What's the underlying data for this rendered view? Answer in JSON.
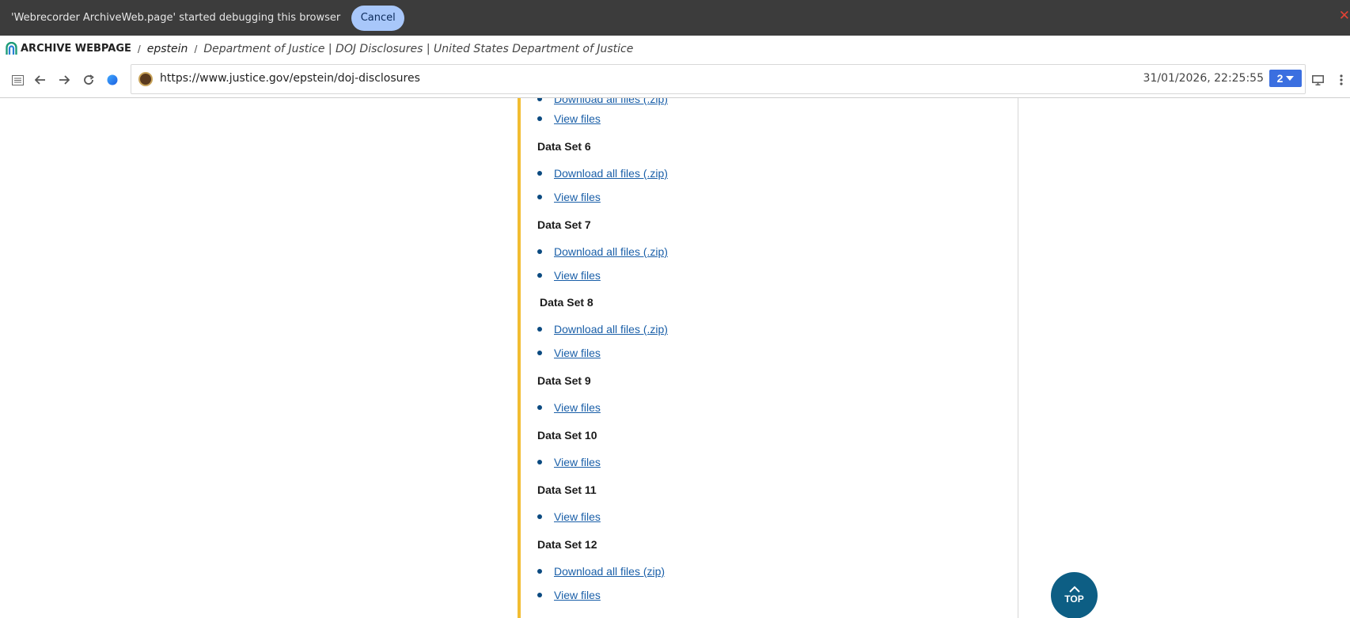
{
  "debug_banner": {
    "message": "'Webrecorder ArchiveWeb.page' started debugging this browser",
    "cancel_label": "Cancel",
    "close_symbol": "✕"
  },
  "archive_bar": {
    "app_title": "ARCHIVE WEBPAGE",
    "separator": "/",
    "collection": "epstein",
    "page_title": "Department of Justice | DOJ Disclosures | United States Department of Justice"
  },
  "nav": {
    "url": "https://www.justice.gov/epstein/doj-disclosures",
    "timestamp": "31/01/2026, 22:25:55",
    "version_count": "2",
    "icons": [
      "sidebar-icon",
      "back-icon",
      "forward-icon",
      "reload-icon",
      "status-dot-icon",
      "screen-icon",
      "more-menu-icon"
    ]
  },
  "data_sets": [
    {
      "heading": "",
      "links": [
        "Download all files (.zip)",
        "View files"
      ]
    },
    {
      "heading": "Data Set 6",
      "links": [
        "Download all files (.zip)",
        "View files"
      ]
    },
    {
      "heading": "Data Set 7",
      "links": [
        "Download all files (.zip)",
        "View files"
      ]
    },
    {
      "heading": "Data Set 8",
      "links": [
        "Download all files (.zip)",
        "View files"
      ]
    },
    {
      "heading": "Data Set 9",
      "links": [
        "View files"
      ]
    },
    {
      "heading": "Data Set 10",
      "links": [
        "View files"
      ]
    },
    {
      "heading": "Data Set 11",
      "links": [
        "View files"
      ]
    },
    {
      "heading": "Data Set 12",
      "links": [
        "Download all files (zip)",
        "View files"
      ]
    }
  ],
  "top_button": {
    "label": "TOP"
  },
  "colors": {
    "accent_line": "#f2bd32",
    "link": "#1a5fa8",
    "top_button": "#0d5e84",
    "version_button": "#3b6fe0",
    "cancel_button": "#a8c7fa"
  }
}
